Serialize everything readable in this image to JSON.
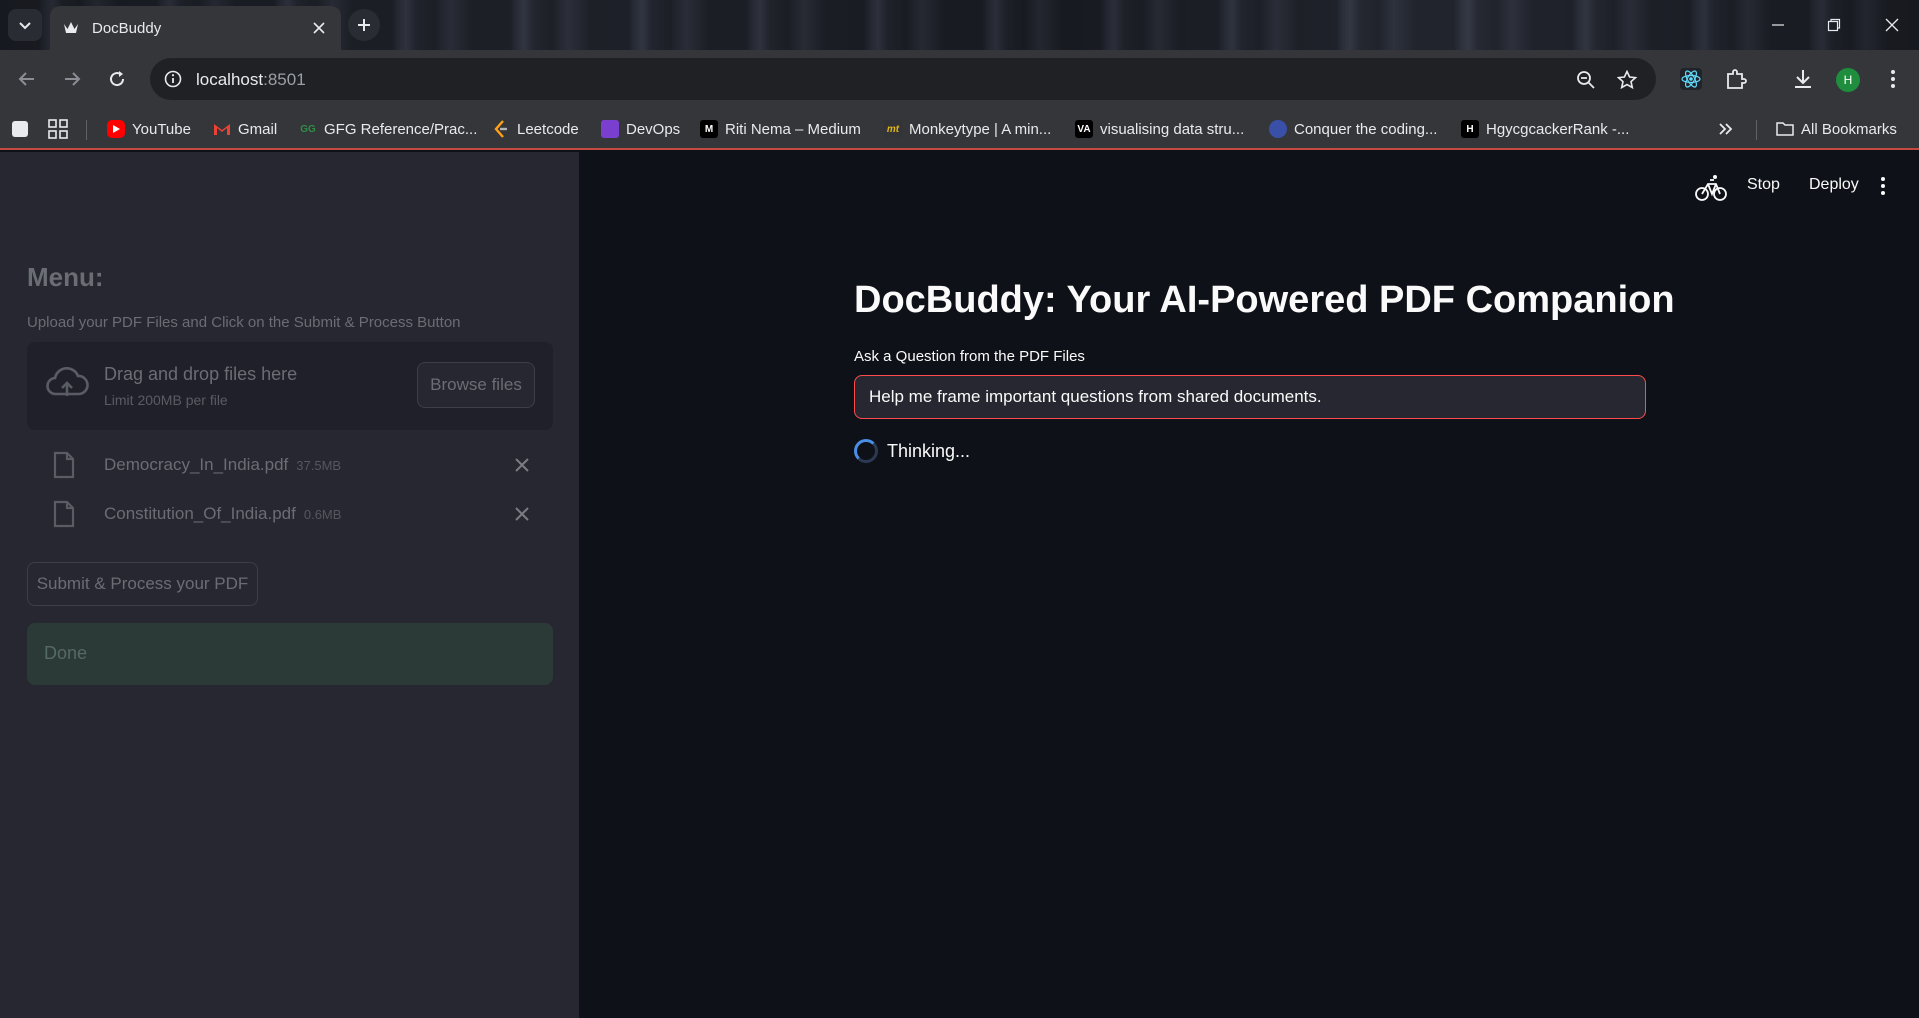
{
  "browser": {
    "tab_title": "DocBuddy",
    "url_host": "localhost",
    "url_port": ":8501",
    "bookmarks": [
      {
        "label": "YouTube",
        "icon": "youtube-icon",
        "color": "#ff0000"
      },
      {
        "label": "Gmail",
        "icon": "gmail-icon",
        "color": "#ea4335"
      },
      {
        "label": "GFG Reference/Prac...",
        "icon": "gfg-icon",
        "color": "#2f8d46"
      },
      {
        "label": "Leetcode",
        "icon": "leetcode-icon",
        "color": "#ffa116"
      },
      {
        "label": "DevOps",
        "icon": "devops-icon",
        "color": "#7b3fd0"
      },
      {
        "label": "Riti Nema – Medium",
        "icon": "medium-icon",
        "color": "#000000"
      },
      {
        "label": "Monkeytype | A min...",
        "icon": "monkeytype-icon",
        "color": "#e2b714"
      },
      {
        "label": "visualising data stru...",
        "icon": "visualgo-icon",
        "color": "#000000"
      },
      {
        "label": "Conquer the coding...",
        "icon": "codechef-icon",
        "color": "#4a6ee0"
      },
      {
        "label": "HgycgcackerRank -...",
        "icon": "hackerrank-icon",
        "color": "#1ba94c"
      }
    ],
    "all_bookmarks_label": "All Bookmarks",
    "profile_initial": "H"
  },
  "app": {
    "header": {
      "stop_label": "Stop",
      "deploy_label": "Deploy"
    },
    "sidebar": {
      "menu_title": "Menu:",
      "upload_label": "Upload your PDF Files and Click on the Submit & Process Button",
      "dropzone_title": "Drag and drop files here",
      "dropzone_limit": "Limit 200MB per file",
      "browse_label": "Browse files",
      "files": [
        {
          "name": "Democracy_In_India.pdf",
          "size": "37.5MB"
        },
        {
          "name": "Constitution_Of_India.pdf",
          "size": "0.6MB"
        }
      ],
      "submit_label": "Submit & Process your PDF",
      "status_text": "Done"
    },
    "main": {
      "title": "DocBuddy: Your AI-Powered PDF Companion",
      "question_label": "Ask a Question from the PDF Files",
      "question_value": "Help me frame important questions from shared documents.",
      "spinner_text": "Thinking..."
    }
  },
  "colors": {
    "accent": "#ff4b4b",
    "sidebar_bg": "#262730",
    "main_bg": "#0e1117",
    "success_bg": "#2b3a36"
  }
}
